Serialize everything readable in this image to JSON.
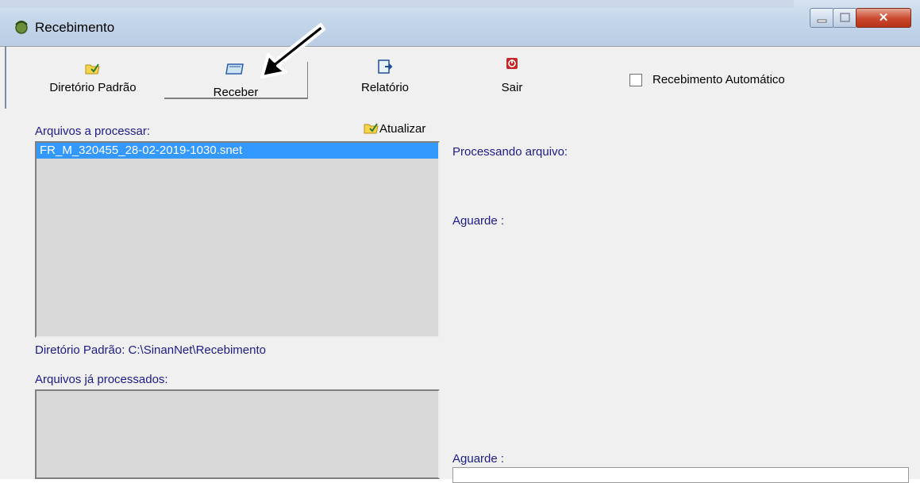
{
  "window": {
    "title": "Recebimento"
  },
  "toolbar": {
    "diretorio_label": "Diretório Padrão",
    "receber_label": "Receber",
    "relatorio_label": "Relatório",
    "sair_label": "Sair",
    "auto_label": "Recebimento Automático",
    "auto_checked": false
  },
  "left_panel": {
    "to_process_label": "Arquivos a processar:",
    "refresh_label": "Atualizar",
    "files_to_process": [
      "FR_M_320455_28-02-2019-1030.snet"
    ],
    "default_dir_text": "Diretório Padrão: C:\\SinanNet\\Recebimento",
    "processed_label": "Arquivos já processados:"
  },
  "right_panel": {
    "processing_label": "Processando arquivo:",
    "wait_label_1": "Aguarde :",
    "wait_label_2": "Aguarde :"
  },
  "icons": {
    "folder": "folder-icon",
    "receive": "receive-icon",
    "report": "report-icon",
    "exit": "exit-icon",
    "app": "app-icon"
  },
  "colors": {
    "label_text": "#1c1c8c",
    "selection": "#3399ff",
    "list_bg": "#d9d9d9"
  }
}
